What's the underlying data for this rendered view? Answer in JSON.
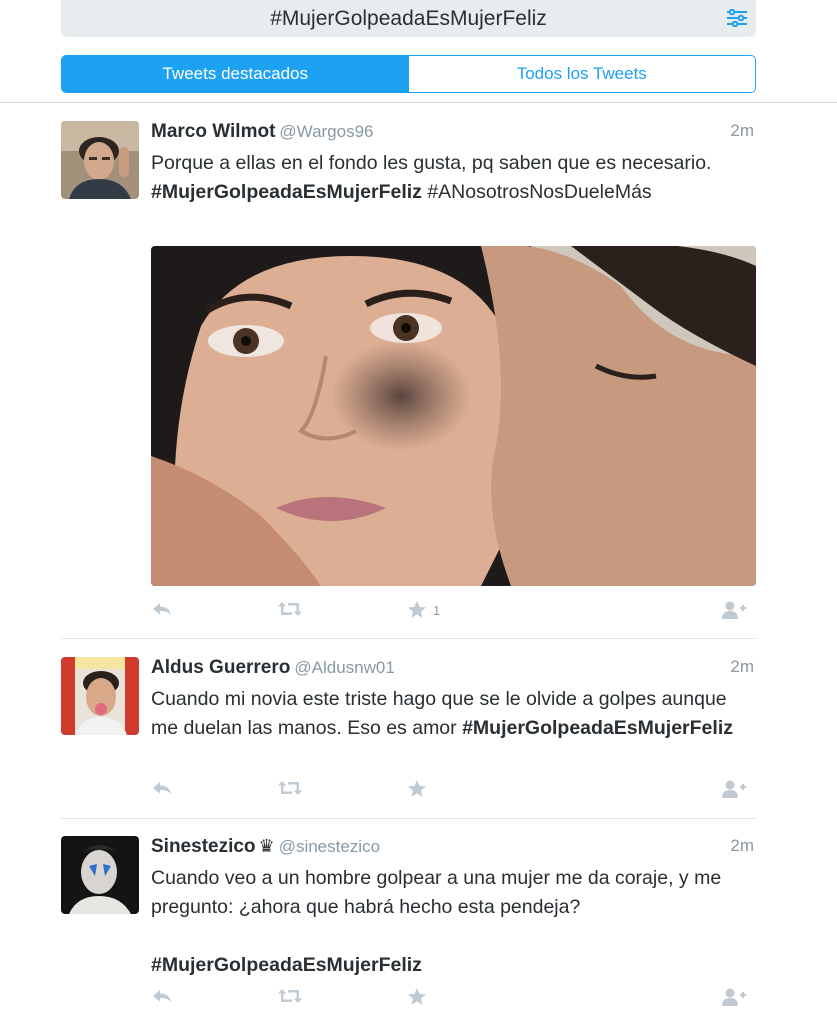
{
  "search": {
    "query": "#MujerGolpeadaEsMujerFeliz",
    "filter_icon": "sliders-icon"
  },
  "tabs": [
    {
      "label": "Tweets destacados",
      "active": true
    },
    {
      "label": "Todos los Tweets",
      "active": false
    }
  ],
  "colors": {
    "accent": "#1da1f2",
    "text": "#292f33",
    "muted": "#8899a6",
    "icon": "#c0cad3"
  },
  "tweets": [
    {
      "name": "Marco Wilmot",
      "handle": "@Wargos96",
      "time": "2m",
      "text_before": "Porque a ellas en el fondo les gusta, pq saben que es necesario. ",
      "tag": "#MujerGolpeadaEsMujerFeliz",
      "text_after": " #ANosotrosNosDueleMás",
      "has_image": true,
      "favorites": "1"
    },
    {
      "name": "Aldus Guerrero",
      "handle": "@Aldusnw01",
      "time": "2m",
      "text_before": "Cuando mi novia este triste hago que se le olvide a golpes aunque me duelan las manos. Eso es amor ",
      "tag": "#MujerGolpeadaEsMujerFeliz",
      "text_after": "",
      "has_image": false,
      "favorites": ""
    },
    {
      "name": "Sinestezico",
      "name_badge": "♛",
      "handle": "@sinestezico",
      "time": "2m",
      "text_before": "Cuando veo a un hombre golpear a una mujer me da coraje, y me pregunto: ¿ahora que habrá hecho esta pendeja?",
      "tag": "#MujerGolpeadaEsMujerFeliz",
      "text_after": "",
      "has_image": false,
      "favorites": ""
    }
  ],
  "action_icons": [
    "reply-icon",
    "retweet-icon",
    "favorite-star-icon",
    "follow-icon"
  ]
}
